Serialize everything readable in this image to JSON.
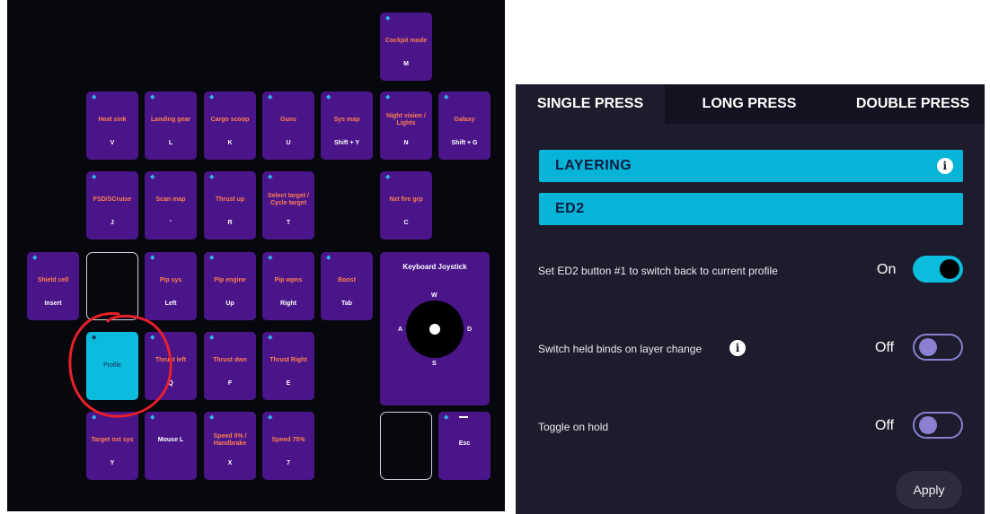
{
  "grid": {
    "keys": [
      {
        "label": "Cockpit mode",
        "bind": "M"
      },
      {
        "label": "Heat sink",
        "bind": "V"
      },
      {
        "label": "Landing gear",
        "bind": "L"
      },
      {
        "label": "Cargo scoop",
        "bind": "K"
      },
      {
        "label": "Guns",
        "bind": "U"
      },
      {
        "label": "Sys map",
        "bind": "Shift + Y"
      },
      {
        "label": "Night vision / Lights",
        "bind": "N"
      },
      {
        "label": "Galaxy",
        "bind": "Shift + G"
      },
      {
        "label": "FSD/SCruise",
        "bind": "J"
      },
      {
        "label": "Scan map",
        "bind": "'"
      },
      {
        "label": "Thrust up",
        "bind": "R"
      },
      {
        "label": "Select target / Cycle target",
        "bind": "T"
      },
      {
        "label": "Nxt fire grp",
        "bind": "C"
      },
      {
        "label": "Shield cell",
        "bind": "Insert"
      },
      {
        "label": "Pip sys",
        "bind": "Left"
      },
      {
        "label": "Pip engine",
        "bind": "Up"
      },
      {
        "label": "Pip wpns",
        "bind": "Right"
      },
      {
        "label": "Boost",
        "bind": "Tab"
      },
      {
        "label": "Profile",
        "bind": ""
      },
      {
        "label": "Thrust left",
        "bind": "Q"
      },
      {
        "label": "Thrust dwn",
        "bind": "F"
      },
      {
        "label": "Thrust Right",
        "bind": "E"
      },
      {
        "label": "Target nxt sys",
        "bind": "Y"
      },
      {
        "label": "Mouse L",
        "bind": ""
      },
      {
        "label": "Speed 0% / Handbrake",
        "bind": "X"
      },
      {
        "label": "Speed 75%",
        "bind": "7"
      },
      {
        "label": "Esc",
        "bind": ""
      }
    ],
    "joystick": {
      "title": "Keyboard Joystick",
      "up": "W",
      "left": "A",
      "right": "D",
      "down": "S"
    },
    "dot_glyph": "◆",
    "accent_color": "#0bbcdc",
    "key_color": "#4b158a",
    "label_color": "#ff7f50",
    "annotation_color": "#e8202a"
  },
  "settings": {
    "tabs": [
      {
        "label": "SINGLE PRESS",
        "active": true
      },
      {
        "label": "LONG PRESS",
        "active": false
      },
      {
        "label": "DOUBLE PRESS",
        "active": false
      }
    ],
    "layer_bar": {
      "label": "LAYERING",
      "info_glyph": "i"
    },
    "profile_bar": {
      "label": "ED2"
    },
    "options": [
      {
        "label": "Set ED2 button #1 to switch back to current profile",
        "state": "On",
        "enabled": true
      },
      {
        "label": "Switch held binds on layer change",
        "state": "Off",
        "enabled": false,
        "info_glyph": "i"
      },
      {
        "label": "Toggle on hold",
        "state": "Off",
        "enabled": false
      }
    ],
    "apply_label": "Apply"
  }
}
